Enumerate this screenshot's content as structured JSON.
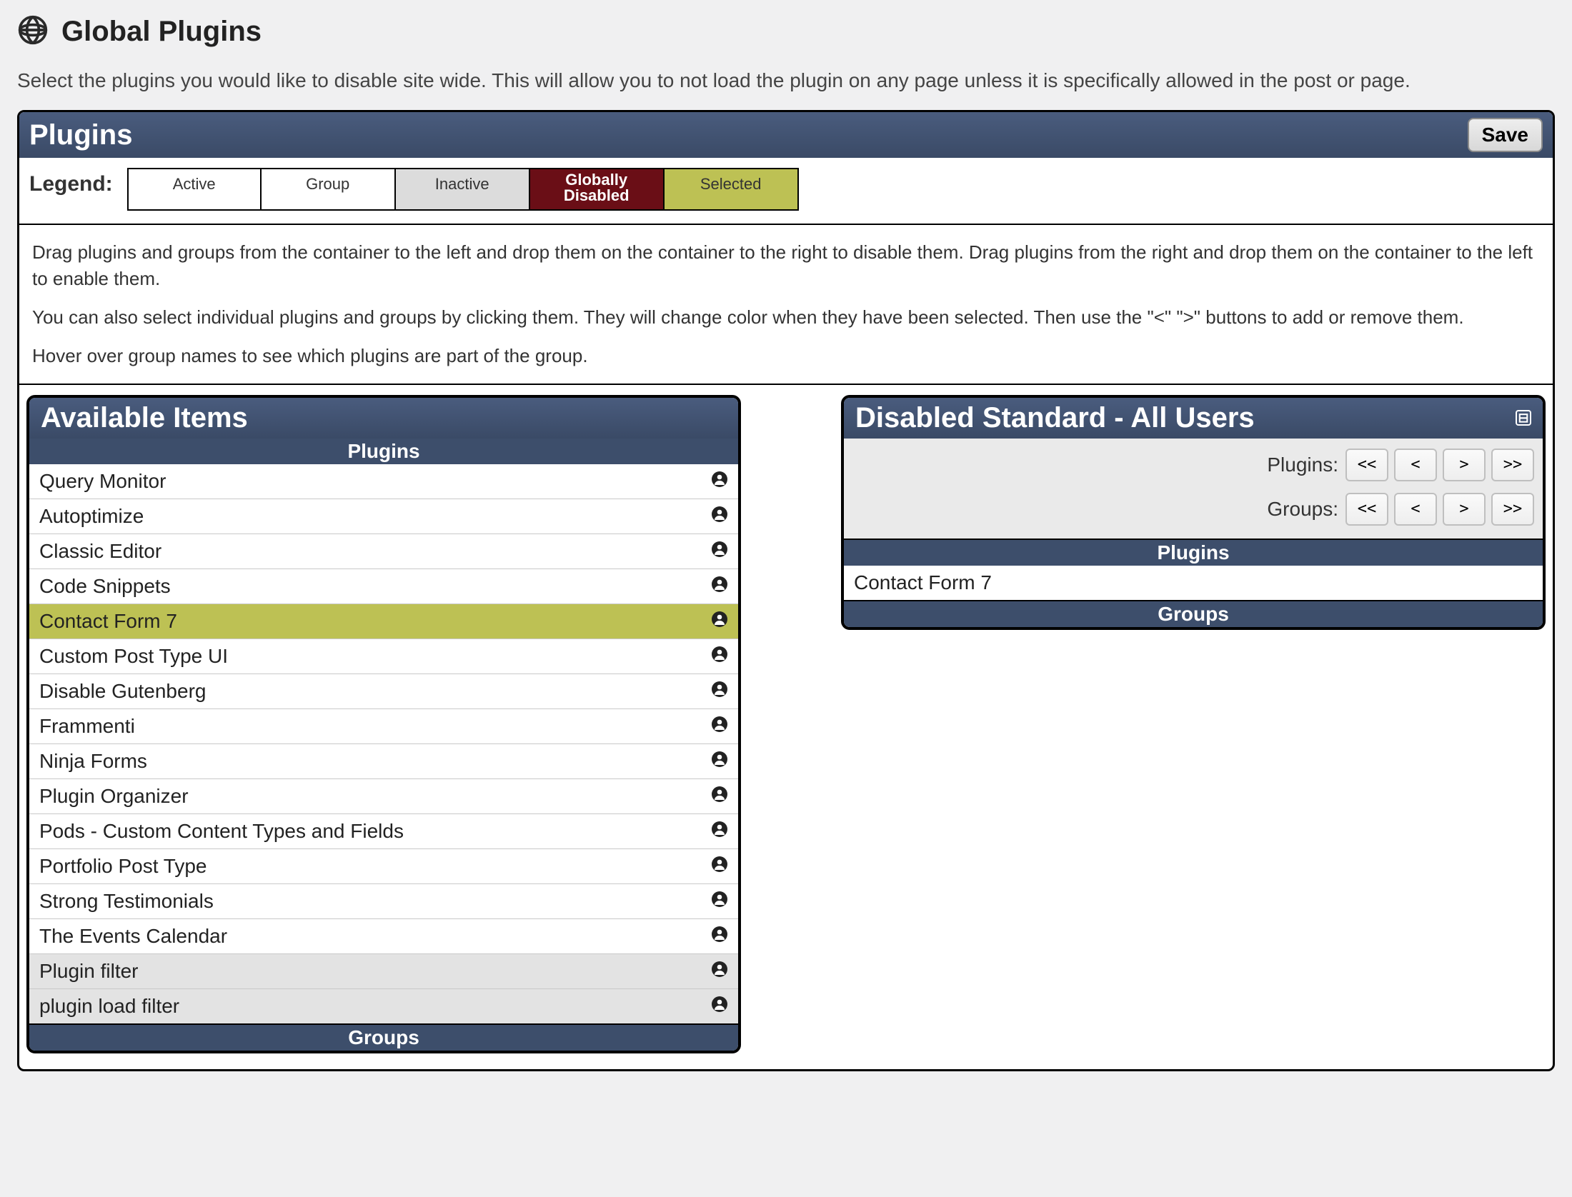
{
  "header": {
    "title": "Global Plugins"
  },
  "intro": "Select the plugins you would like to disable site wide. This will allow you to not load the plugin on any page unless it is specifically allowed in the post or page.",
  "panel": {
    "title": "Plugins",
    "save_label": "Save"
  },
  "legend": {
    "label": "Legend:",
    "active": "Active",
    "group": "Group",
    "inactive": "Inactive",
    "globally_disabled_line1": "Globally",
    "globally_disabled_line2": "Disabled",
    "selected": "Selected"
  },
  "instructions": {
    "p1": "Drag plugins and groups from the container to the left and drop them on the container to the right to disable them. Drag plugins from the right and drop them on the container to the left to enable them.",
    "p2": "You can also select individual plugins and groups by clicking them. They will change color when they have been selected. Then use the \"<\" \">\" buttons to add or remove them.",
    "p3": "Hover over group names to see which plugins are part of the group."
  },
  "available": {
    "title": "Available Items",
    "plugins_header": "Plugins",
    "groups_header": "Groups",
    "items": [
      {
        "label": "Query Monitor",
        "state": "active"
      },
      {
        "label": "Autoptimize",
        "state": "active"
      },
      {
        "label": "Classic Editor",
        "state": "active"
      },
      {
        "label": "Code Snippets",
        "state": "active"
      },
      {
        "label": "Contact Form 7",
        "state": "selected"
      },
      {
        "label": "Custom Post Type UI",
        "state": "active"
      },
      {
        "label": "Disable Gutenberg",
        "state": "active"
      },
      {
        "label": "Frammenti",
        "state": "active"
      },
      {
        "label": "Ninja Forms",
        "state": "active"
      },
      {
        "label": "Plugin Organizer",
        "state": "active"
      },
      {
        "label": "Pods - Custom Content Types and Fields",
        "state": "active"
      },
      {
        "label": "Portfolio Post Type",
        "state": "active"
      },
      {
        "label": "Strong Testimonials",
        "state": "active"
      },
      {
        "label": "The Events Calendar",
        "state": "active"
      },
      {
        "label": "Plugin filter",
        "state": "inactive"
      },
      {
        "label": "plugin load filter",
        "state": "inactive"
      }
    ]
  },
  "disabled": {
    "title": "Disabled Standard - All Users",
    "plugins_row_label": "Plugins:",
    "groups_row_label": "Groups:",
    "buttons": {
      "all_left": "<<",
      "left": "<",
      "right": ">",
      "all_right": ">>"
    },
    "plugins_header": "Plugins",
    "groups_header": "Groups",
    "items": [
      {
        "label": "Contact Form 7"
      }
    ]
  }
}
